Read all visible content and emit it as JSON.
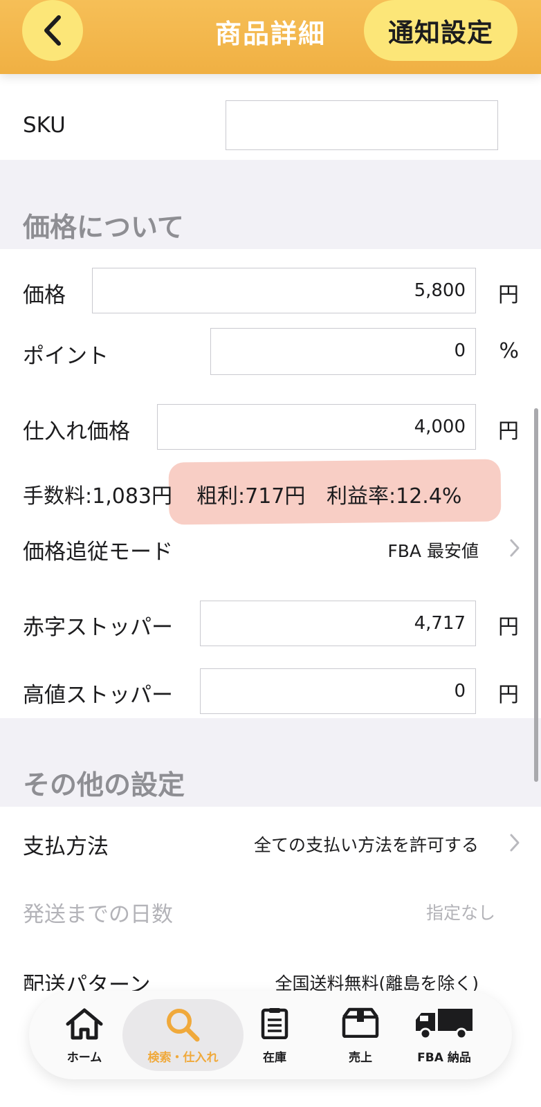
{
  "header": {
    "title": "商品詳細",
    "notify_label": "通知設定"
  },
  "sku": {
    "label": "SKU",
    "value": ""
  },
  "price_section": {
    "title": "価格について",
    "price": {
      "label": "価格",
      "value": "5,800",
      "unit": "円"
    },
    "point": {
      "label": "ポイント",
      "value": "0",
      "unit": "%"
    },
    "cost": {
      "label": "仕入れ価格",
      "value": "4,000",
      "unit": "円"
    },
    "fee": "手数料:1,083円",
    "gross_profit": "粗利:717円",
    "profit_rate": "利益率:12.4%",
    "tracking_mode": {
      "label": "価格追従モード",
      "value": "FBA 最安値"
    },
    "loss_stopper": {
      "label": "赤字ストッパー",
      "value": "4,717",
      "unit": "円"
    },
    "high_stopper": {
      "label": "高値ストッパー",
      "value": "0",
      "unit": "円"
    }
  },
  "other_section": {
    "title": "その他の設定",
    "payment": {
      "label": "支払方法",
      "value": "全ての支払い方法を許可する"
    },
    "shipping_days": {
      "label": "発送までの日数",
      "value": "指定なし"
    },
    "shipping_pattern": {
      "label": "配送パターン",
      "value": "全国送料無料(離島を除く)"
    }
  },
  "tabbar": {
    "items": [
      {
        "label": "ホーム",
        "icon": "home-icon"
      },
      {
        "label": "検索・仕入れ",
        "icon": "search-icon",
        "active": true
      },
      {
        "label": "在庫",
        "icon": "inventory-icon"
      },
      {
        "label": "売上",
        "icon": "sales-box-icon"
      },
      {
        "label": "FBA 納品",
        "icon": "truck-icon"
      }
    ],
    "active_color": "#f0a93b"
  },
  "colors": {
    "header": "#f0b043",
    "button": "#fce678",
    "highlight": "#f7c5bb"
  }
}
